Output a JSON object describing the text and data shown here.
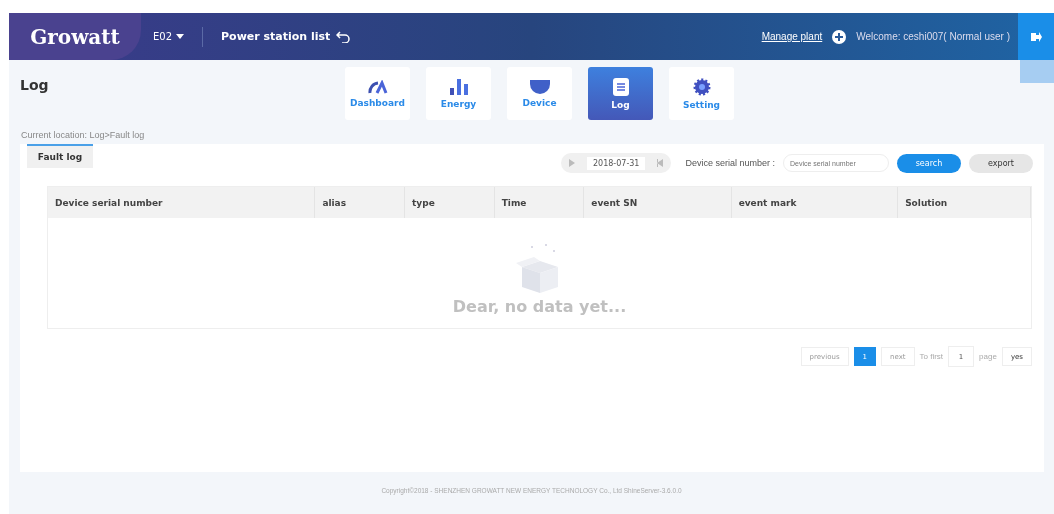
{
  "header": {
    "logo": "Growatt",
    "plant": "E02",
    "station_list": "Power station list",
    "manage_plant": "Manage plant",
    "welcome": "Welcome: ceshi007( Normal user )"
  },
  "page_title": "Log",
  "nav": [
    {
      "label": "Dashboard",
      "kind": "gauge",
      "selected": false
    },
    {
      "label": "Energy",
      "kind": "bars",
      "selected": false
    },
    {
      "label": "Device",
      "kind": "device",
      "selected": false
    },
    {
      "label": "Log",
      "kind": "log",
      "selected": true
    },
    {
      "label": "Setting",
      "kind": "gear",
      "selected": false
    }
  ],
  "breadcrumb": "Current location: Log>Fault log",
  "tabs": [
    {
      "label": "Fault log",
      "selected": true
    }
  ],
  "toolbar": {
    "date": "2018-07-31",
    "serial_label": "Device serial number :",
    "serial_placeholder": "Device serial number",
    "search": "search",
    "export": "export"
  },
  "table": {
    "columns": [
      "Device serial number",
      "alias",
      "type",
      "Time",
      "event SN",
      "event mark",
      "Solution"
    ],
    "empty_text": "Dear, no data yet..."
  },
  "pagination": {
    "previous": "previous",
    "pages": [
      {
        "label": "1",
        "selected": true
      }
    ],
    "next": "next",
    "to_first": "To first",
    "page_value": "1",
    "page_label": "page",
    "go": "yes"
  },
  "footer": "Copyright©2018 - SHENZHEN GROWATT NEW ENERGY TECHNOLOGY Co., Ltd ShineServer-3.6.0.0"
}
